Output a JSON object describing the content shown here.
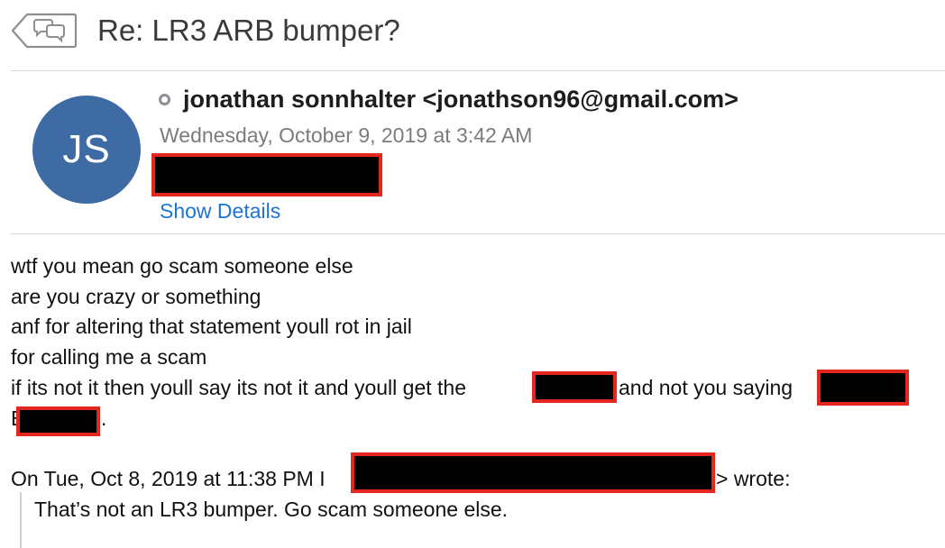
{
  "header": {
    "back_icon": "back-conversation-icon",
    "subject": "Re: LR3 ARB bumper?"
  },
  "sender": {
    "avatar_initials": "JS",
    "avatar_color": "#3e6ba4",
    "status_icon": "status-circle-icon",
    "name_email": "jonathan sonnhalter <jonathson96@gmail.com>",
    "date": "Wednesday, October 9, 2019 at 3:42 AM",
    "show_details": "Show Details"
  },
  "body": {
    "lines": [
      "wtf you mean go scam someone else",
      "are you crazy or something",
      "anf for altering that statement youll rot in jail",
      "for calling me a scam"
    ],
    "line5_a": "if its not it then youll say its not it and youll get the",
    "line5_b": "and not you saying",
    "line6_lead": "E",
    "line6_tail": "."
  },
  "quote": {
    "header_prefix": "On Tue, Oct 8, 2019 at 11:38 PM",
    "header_lead": "I",
    "header_suffix": "> wrote:",
    "text": "That’s not an LR3 bumper. Go scam someone else."
  },
  "colors": {
    "link": "#1c74d8",
    "redaction_border": "#e2271e",
    "redaction_fill": "#000000"
  }
}
